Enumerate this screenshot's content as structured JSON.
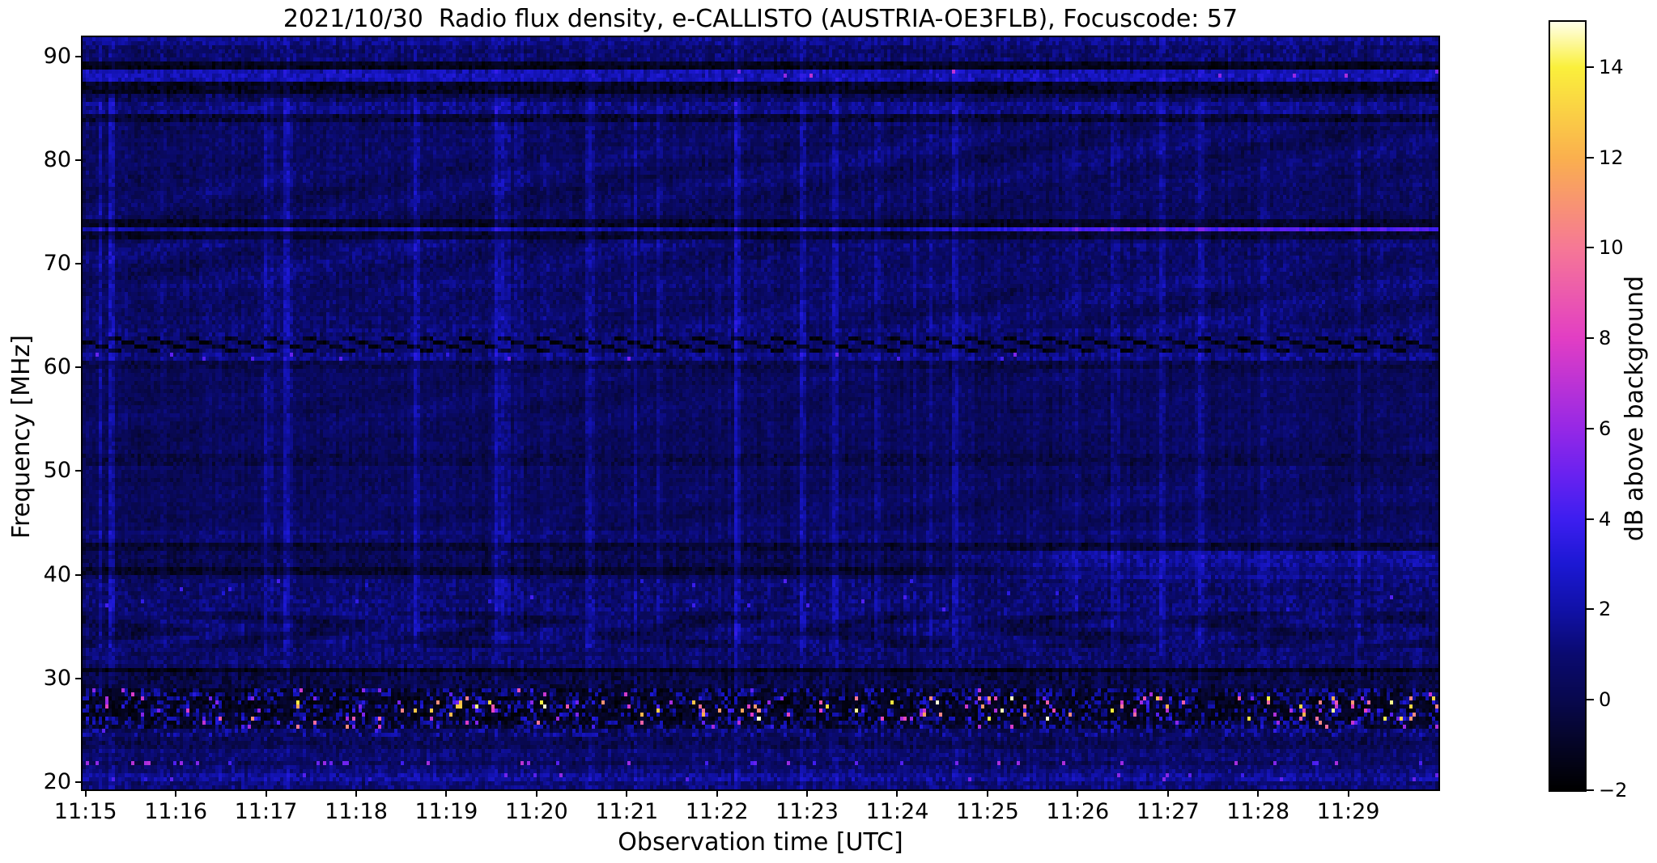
{
  "figure": {
    "title": "2021/10/30  Radio flux density, e-CALLISTO (AUSTRIA-OE3FLB), Focuscode: 57",
    "xlabel": "Observation time [UTC]",
    "ylabel": "Frequency [MHz]",
    "colorbar_label": "dB above background"
  },
  "chart_data": {
    "type": "heatmap",
    "title": "2021/10/30  Radio flux density, e-CALLISTO (AUSTRIA-OE3FLB), Focuscode: 57",
    "xlabel": "Observation time [UTC]",
    "ylabel": "Frequency [MHz]",
    "x_ticks": [
      "11:15",
      "11:16",
      "11:17",
      "11:18",
      "11:19",
      "11:20",
      "11:21",
      "11:22",
      "11:23",
      "11:24",
      "11:25",
      "11:26",
      "11:27",
      "11:28",
      "11:29"
    ],
    "x_first_tick_s": 2,
    "x_tick_interval_s": 60,
    "x_duration_s": 902,
    "y_ticks": [
      90,
      80,
      70,
      60,
      50,
      40,
      30,
      20
    ],
    "y_tick_labels": [
      "90",
      "80",
      "70",
      "60",
      "50",
      "40",
      "30",
      "20"
    ],
    "freq_top_mhz": 91.87,
    "freq_bottom_mhz": 19.29,
    "value_range_db": [
      -2,
      15
    ],
    "colorbar_ticks": [
      14,
      12,
      10,
      8,
      6,
      4,
      2,
      0,
      -2
    ],
    "colorbar_tick_labels": [
      "14",
      "12",
      "10",
      "8",
      "6",
      "4",
      "2",
      "0",
      "−2"
    ],
    "colormap_name": "gnuplot2-like",
    "colormap_stops": [
      [
        -2,
        0,
        0,
        0
      ],
      [
        -1,
        5,
        5,
        38
      ],
      [
        0,
        8,
        8,
        78
      ],
      [
        1,
        10,
        10,
        112
      ],
      [
        2,
        17,
        17,
        168
      ],
      [
        3,
        28,
        24,
        212
      ],
      [
        4,
        62,
        30,
        240
      ],
      [
        5,
        106,
        34,
        240
      ],
      [
        6,
        150,
        40,
        230
      ],
      [
        8,
        226,
        62,
        196
      ],
      [
        10,
        246,
        120,
        150
      ],
      [
        12,
        250,
        176,
        78
      ],
      [
        14,
        250,
        240,
        60
      ],
      [
        15,
        255,
        255,
        232
      ]
    ],
    "grid_cols": 418,
    "grid_rows": 186,
    "seed": 1337,
    "legend": "spectrogram of radio flux density vs time and frequency; dark-blue background, horizontal interference bands, strong speckled RFI band near 25-28 MHz",
    "bands": [
      {
        "fh": 92.0,
        "fl": 91.0,
        "b": 1.5,
        "n": 0.8
      },
      {
        "fh": 91.0,
        "fl": 89.7,
        "b": 0.9,
        "n": 0.9
      },
      {
        "fh": 89.7,
        "fl": 88.7,
        "b": -1.2,
        "n": 0.6
      },
      {
        "fh": 88.7,
        "fl": 87.5,
        "b": 2.3,
        "n": 0.8,
        "hp": 0.004,
        "hv": [
          5,
          7
        ]
      },
      {
        "fh": 87.5,
        "fl": 86.5,
        "b": -1.1,
        "n": 0.7
      },
      {
        "fh": 86.5,
        "fl": 85.5,
        "b": 0.3,
        "n": 1.0
      },
      {
        "fh": 85.5,
        "fl": 84.5,
        "b": 1.3,
        "n": 0.8
      },
      {
        "fh": 84.5,
        "fl": 83.7,
        "b": -0.7,
        "n": 0.8
      },
      {
        "fh": 83.7,
        "fl": 83.1,
        "b": 0.7,
        "n": 0.8
      },
      {
        "fh": 83.1,
        "fl": 74.3,
        "b": 0.55,
        "n": 0.7,
        "t": "wavy",
        "wa": 0.5
      },
      {
        "fh": 74.3,
        "fl": 73.5,
        "b": -1.0,
        "n": 0.55
      },
      {
        "fh": 73.5,
        "fl": 73.0,
        "b": 2.0,
        "n": 0.5,
        "rb": 2.3
      },
      {
        "fh": 73.0,
        "fl": 72.4,
        "b": -0.8,
        "n": 0.55
      },
      {
        "fh": 72.4,
        "fl": 63.9,
        "b": 0.75,
        "n": 0.75,
        "t": "wavy",
        "wa": 0.5
      },
      {
        "fh": 63.9,
        "fl": 63.1,
        "b": 1.0,
        "n": 0.9
      },
      {
        "fh": 63.1,
        "fl": 61.3,
        "b": 0.7,
        "n": 0.7,
        "t": "dashes"
      },
      {
        "fh": 61.3,
        "fl": 60.5,
        "b": 1.3,
        "n": 0.9,
        "hp": 0.012,
        "hv": [
          3.5,
          5.5
        ]
      },
      {
        "fh": 60.5,
        "fl": 59.9,
        "b": -0.2,
        "n": 0.8
      },
      {
        "fh": 59.9,
        "fl": 51.6,
        "b": 0.45,
        "n": 0.6,
        "t": "wavy",
        "wa": 0.3
      },
      {
        "fh": 51.6,
        "fl": 50.6,
        "b": 0.0,
        "n": 0.7
      },
      {
        "fh": 50.6,
        "fl": 44.1,
        "b": 0.45,
        "n": 0.6,
        "t": "wavy",
        "wa": 0.3
      },
      {
        "fh": 44.1,
        "fl": 42.9,
        "b": 0.85,
        "n": 0.7
      },
      {
        "fh": 42.9,
        "fl": 42.3,
        "b": -0.6,
        "n": 0.7
      },
      {
        "fh": 42.3,
        "fl": 40.7,
        "b": 0.2,
        "n": 0.8,
        "rb": 1.6
      },
      {
        "fh": 40.7,
        "fl": 40.1,
        "b": -1.0,
        "n": 0.6,
        "rb": 2.1
      },
      {
        "fh": 40.1,
        "fl": 39.5,
        "b": 0.4,
        "n": 0.8,
        "rb": 1.2
      },
      {
        "fh": 39.5,
        "fl": 36.3,
        "b": 0.9,
        "n": 0.9,
        "hp": 0.006,
        "hv": [
          3,
          4.5
        ]
      },
      {
        "fh": 36.3,
        "fl": 33.1,
        "b": 0.5,
        "n": 0.8,
        "t": "wavy2"
      },
      {
        "fh": 33.1,
        "fl": 31.1,
        "b": 0.8,
        "n": 0.9
      },
      {
        "fh": 31.1,
        "fl": 30.5,
        "b": -1.4,
        "n": 0.45
      },
      {
        "fh": 30.5,
        "fl": 28.9,
        "b": -0.1,
        "n": 1.0
      },
      {
        "fh": 28.9,
        "fl": 28.3,
        "b": -1.0,
        "n": 0.7,
        "t": "rfi",
        "hp": 0.05,
        "hv": [
          2.5,
          9
        ],
        "bp": 0.3
      },
      {
        "fh": 28.3,
        "fl": 25.9,
        "b": -1.2,
        "n": 0.7,
        "t": "rfi",
        "hp": 0.13,
        "hv": [
          3,
          15
        ],
        "bp": 0.2
      },
      {
        "fh": 25.9,
        "fl": 25.0,
        "b": -0.9,
        "n": 0.7,
        "t": "rfi",
        "hp": 0.07,
        "hv": [
          2.5,
          11
        ],
        "bp": 0.28
      },
      {
        "fh": 25.0,
        "fl": 24.4,
        "b": 0.3,
        "n": 0.8,
        "t": "rfi",
        "hp": 0.02,
        "hv": [
          2,
          5
        ],
        "bp": 0.35
      },
      {
        "fh": 24.4,
        "fl": 23.3,
        "b": 0.35,
        "n": 0.9
      },
      {
        "fh": 23.3,
        "fl": 22.1,
        "b": 0.8,
        "n": 0.8
      },
      {
        "fh": 22.1,
        "fl": 21.5,
        "b": 0.4,
        "n": 0.7,
        "hp": 0.1,
        "hv": [
          4,
          7
        ]
      },
      {
        "fh": 21.5,
        "fl": 20.7,
        "b": 1.0,
        "n": 0.8
      },
      {
        "fh": 20.7,
        "fl": 20.1,
        "b": 1.6,
        "n": 0.9,
        "hp": 0.02,
        "hv": [
          3.5,
          6
        ]
      },
      {
        "fh": 20.1,
        "fl": 19.2,
        "b": 1.0,
        "n": 0.9
      }
    ]
  }
}
